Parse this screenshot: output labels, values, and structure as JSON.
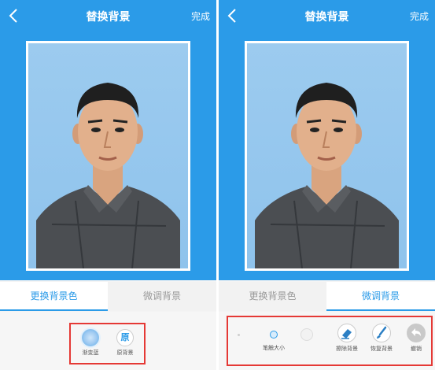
{
  "left": {
    "title": "替换背景",
    "done": "完成",
    "tabs": [
      "更换背景色",
      "微调背景"
    ],
    "tools": [
      {
        "label": "渐变蓝"
      },
      {
        "glyph": "原",
        "label": "原背景"
      }
    ]
  },
  "right": {
    "title": "替换背景",
    "done": "完成",
    "tabs": [
      "更换背景色",
      "微调背景"
    ],
    "tools": [
      {
        "label": "笔触大小"
      },
      {
        "label": "擦除背景"
      },
      {
        "label": "恢复背景"
      },
      {
        "label": "撤销"
      }
    ]
  },
  "colors": {
    "accent": "#2b9be8",
    "highlight_box": "#e53935",
    "photo_background": "#9ccbef"
  }
}
